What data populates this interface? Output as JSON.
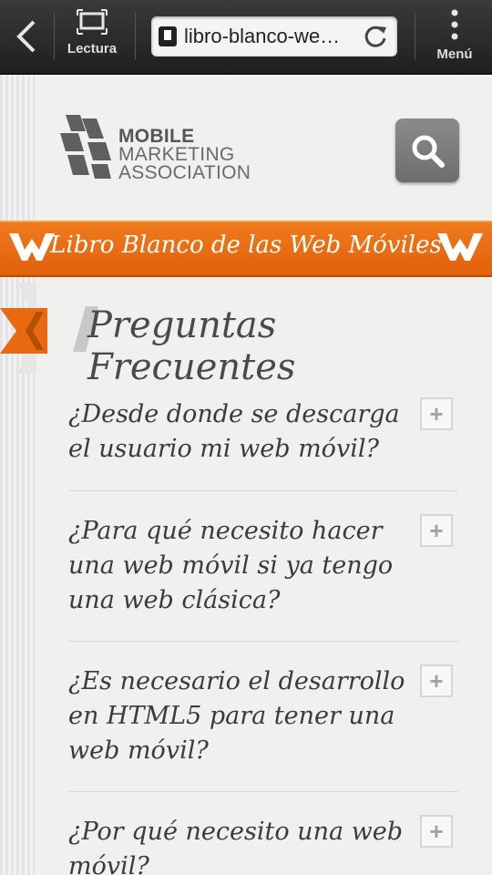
{
  "browser": {
    "reading_label": "Lectura",
    "url_text": "libro-blanco-we…",
    "menu_label": "Menú"
  },
  "logo": {
    "line1": "MOBILE",
    "line2": "MARKETING",
    "line3": "ASSOCIATION"
  },
  "banner": {
    "title": "Libro Blanco de las Web Móviles"
  },
  "section": {
    "title": "Preguntas Frecuentes"
  },
  "faq": [
    {
      "question": "¿Desde donde se descarga el usuario mi web móvil?",
      "toggle": "+"
    },
    {
      "question": "¿Para qué necesito hacer una web móvil si ya tengo una web clásica?",
      "toggle": "+"
    },
    {
      "question": "¿Es necesario el desarrollo en HTML5 para tener una web móvil?",
      "toggle": "+"
    },
    {
      "question": "¿Por qué necesito una web móvil?",
      "toggle": "+"
    }
  ],
  "colors": {
    "accent_orange": "#e8690f",
    "toolbar": "#2b2b2b",
    "search_button": "#7a7a7a"
  },
  "icons": [
    "back-arrow-icon",
    "reading-mode-icon",
    "favicon-icon",
    "reload-icon",
    "menu-dots-icon",
    "search-icon",
    "w-logo-icon",
    "plus-icon"
  ]
}
